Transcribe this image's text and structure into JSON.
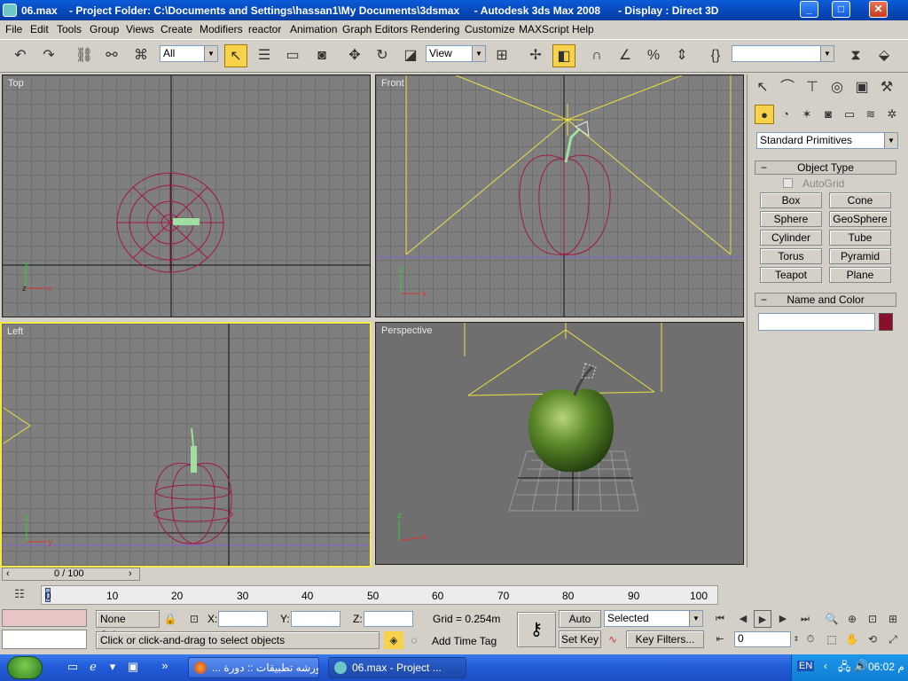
{
  "window": {
    "title": "06.max    - Project Folder: C:\\Documents and Settings\\hassan1\\My Documents\\3dsmax     - Autodesk 3ds Max 2008      - Display : Direct 3D",
    "min": "_",
    "max": "□",
    "close": "✕"
  },
  "menu": [
    "File",
    "Edit",
    "Tools",
    "Group",
    "Views",
    "Create",
    "Modifiers",
    "reactor",
    "Animation",
    "Graph Editors",
    "Rendering",
    "Customize",
    "MAXScript",
    "Help"
  ],
  "toolbar": {
    "selection_filter": "All",
    "ref_coord": "View",
    "named_selection": ""
  },
  "viewports": {
    "top": "Top",
    "front": "Front",
    "left": "Left",
    "perspective": "Perspective"
  },
  "command_panel": {
    "category": "Standard Primitives",
    "object_type_title": "Object Type",
    "autogrid": "AutoGrid",
    "buttons": [
      "Box",
      "Cone",
      "Sphere",
      "GeoSphere",
      "Cylinder",
      "Tube",
      "Torus",
      "Pyramid",
      "Teapot",
      "Plane"
    ],
    "name_color_title": "Name and Color",
    "name_value": "",
    "object_color": "#8a0f2a"
  },
  "timeline": {
    "slider": "0 / 100",
    "ticks": [
      "0",
      "10",
      "20",
      "30",
      "40",
      "50",
      "60",
      "70",
      "80",
      "90",
      "100"
    ]
  },
  "status": {
    "selection": "None Selecte",
    "x_label": "X:",
    "y_label": "Y:",
    "z_label": "Z:",
    "x_value": "",
    "y_value": "",
    "z_value": "",
    "grid": "Grid = 0.254m",
    "prompt": "Click or click-and-drag to select objects",
    "add_time_tag": "Add Time Tag",
    "auto_key": "Auto Key",
    "set_key": "Set Key",
    "key_mode": "Selected",
    "key_filters": "Key Filters...",
    "frame": "0"
  },
  "taskbar": {
    "tasks": [
      "... ورشه تطبيقات :: دورة",
      "06.max    - Project ..."
    ],
    "lang": "EN",
    "clock": "06:02 م"
  }
}
